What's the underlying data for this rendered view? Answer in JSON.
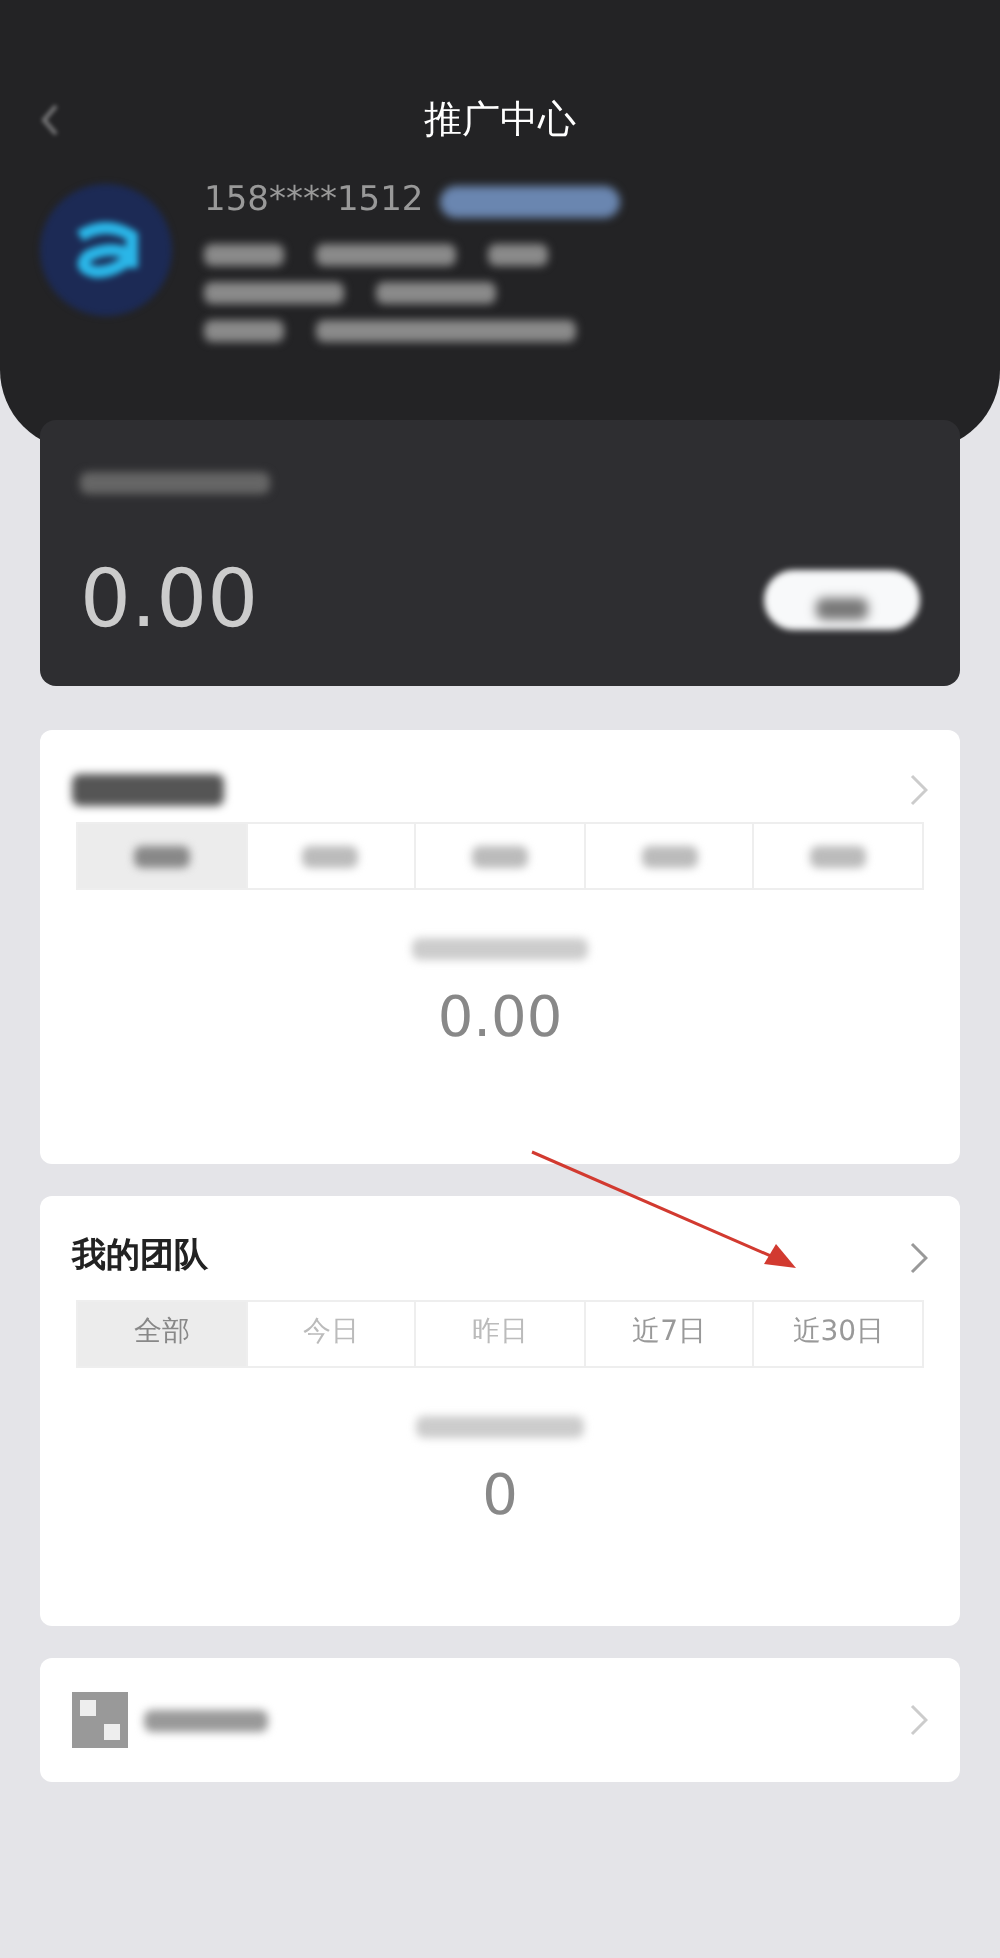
{
  "header": {
    "title": "推广中心",
    "phone": "158****1512"
  },
  "balance": {
    "amount": "0.00"
  },
  "income": {
    "amount": "0.00",
    "tabs": [
      {
        "selected": true
      },
      {
        "selected": false
      },
      {
        "selected": false
      },
      {
        "selected": false
      },
      {
        "selected": false
      }
    ]
  },
  "team": {
    "title": "我的团队",
    "count": "0",
    "tabs": [
      {
        "label": "全部",
        "selected": true
      },
      {
        "label": "今日",
        "selected": false
      },
      {
        "label": "昨日",
        "selected": false
      },
      {
        "label": "近7日",
        "selected": false
      },
      {
        "label": "近30日",
        "selected": false
      }
    ]
  }
}
